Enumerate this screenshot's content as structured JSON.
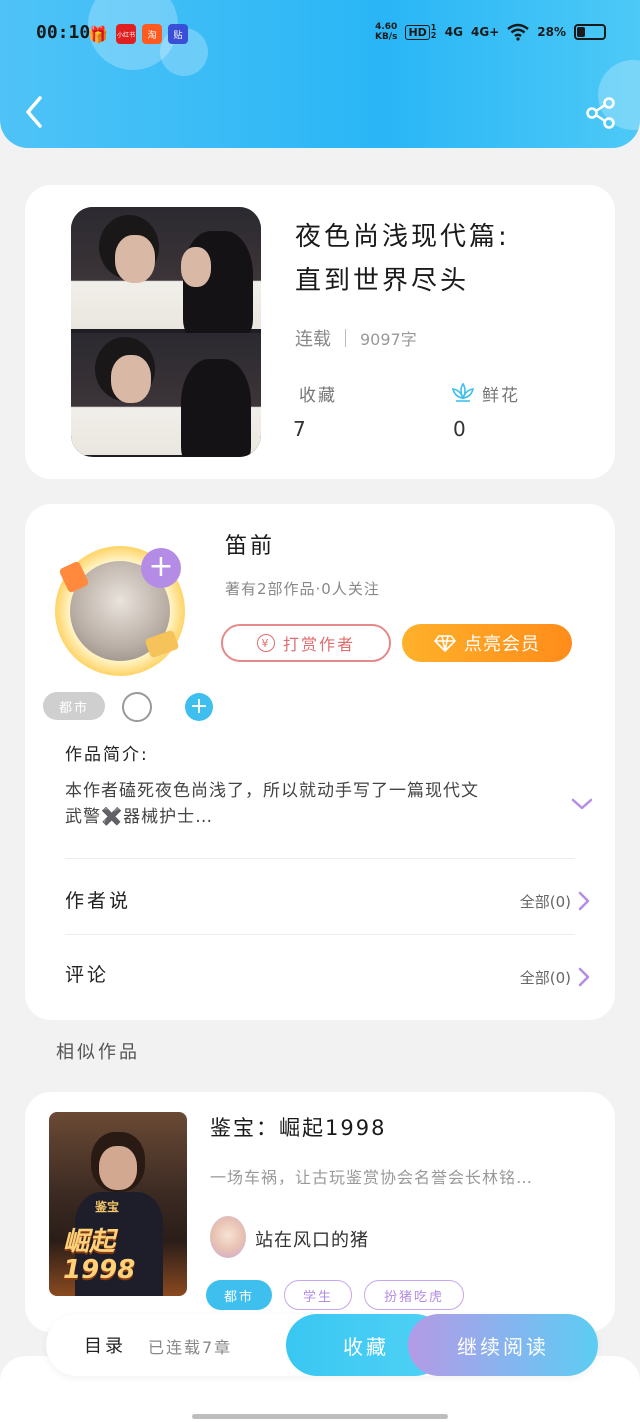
{
  "status_bar": {
    "time": "00:10",
    "app_icons": [
      "小红书",
      "淘",
      "贴"
    ],
    "net_speed_value": "4.60",
    "net_speed_unit": "KB/s",
    "hd": "HD",
    "hd_sim": "1 2",
    "signal1": "4G",
    "signal2": "4G+",
    "battery_percent": "28%",
    "battery_level": 0.28
  },
  "book": {
    "title_line1": "夜色尚浅现代篇:",
    "title_line2": "直到世界尽头",
    "status": "连载",
    "word_count": "9097字",
    "collect_label": "收藏",
    "collect_value": "7",
    "flower_label": "鲜花",
    "flower_value": "0"
  },
  "author": {
    "name": "笛前",
    "subtitle": "著有2部作品·0人关注",
    "tip_button": "打赏作者",
    "tip_icon_char": "¥",
    "vip_button": "点亮会员",
    "tag": "都市",
    "intro_label": "作品简介:",
    "intro_line1": "本作者磕死夜色尚浅了，所以就动手写了一篇现代文",
    "intro_line2": "武警✖️器械护士…",
    "author_say_label": "作者说",
    "author_say_count": "全部(0)",
    "comment_label": "评论",
    "comment_count": "全部(0)"
  },
  "similar": {
    "section_title": "相似作品",
    "title": "鉴宝：崛起1998",
    "desc": "一场车祸，让古玩鉴赏协会名誉会长林铭…",
    "author": "站在风口的猪",
    "cover_text_big": "崛起1998",
    "cover_text_small": "鉴宝",
    "tags": [
      "都市",
      "学生",
      "扮猪吃虎"
    ]
  },
  "bottom_bar": {
    "toc": "目录",
    "chapters": "已连载7章",
    "collect": "收藏",
    "continue": "继续阅读"
  },
  "colors": {
    "header": "#29b6f6",
    "vip": "#ff8c1a",
    "tip": "#e06d6d",
    "accent_purple": "#b48ce6",
    "accent_blue": "#3fbfee"
  }
}
